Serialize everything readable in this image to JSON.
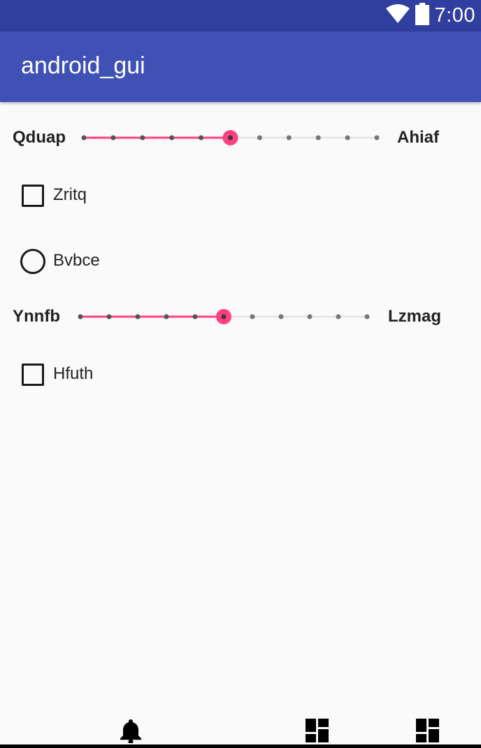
{
  "status_bar": {
    "time": "7:00",
    "icons": [
      "wifi-icon",
      "battery-icon"
    ]
  },
  "app_bar": {
    "title": "android_gui"
  },
  "controls": {
    "slider1": {
      "left_label": "Qduap",
      "right_label": "Ahiaf",
      "steps": 11,
      "value_index": 5
    },
    "checkbox1": {
      "label": "Zritq",
      "checked": false
    },
    "radio1": {
      "label": "Bvbce",
      "checked": false
    },
    "slider2": {
      "left_label": "Ynnfb",
      "right_label": "Lzmag",
      "steps": 11,
      "value_index": 5
    },
    "checkbox2": {
      "label": "Hfuth",
      "checked": false
    }
  },
  "bottom_nav": {
    "items": [
      "bell-icon",
      "dashboard-icon",
      "dashboard-icon"
    ]
  },
  "colors": {
    "status_bar": "#303f9f",
    "app_bar": "#3f51b5",
    "accent": "#ff4081"
  }
}
